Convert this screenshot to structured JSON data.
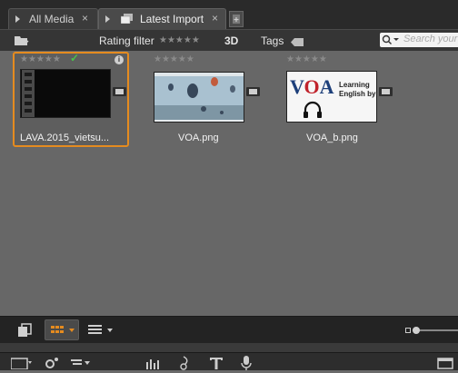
{
  "tabs": [
    {
      "label": "All Media",
      "close": "×"
    },
    {
      "label": "Latest Import",
      "close": "×"
    }
  ],
  "toolbar": {
    "rating_filter_label": "Rating filter",
    "rating_stars": "★★★★★",
    "three_d_label": "3D",
    "tags_label": "Tags",
    "search_placeholder": "Search your"
  },
  "media_items": [
    {
      "filename": "LAVA.2015_vietsu...",
      "stars": "★★★★★",
      "checked": true,
      "checkmark": "✓",
      "info_icon": "i",
      "selected": true
    },
    {
      "filename": "VOA.png",
      "stars": "★★★★★",
      "checked": false,
      "selected": false
    },
    {
      "filename": "VOA_b.png",
      "stars": "★★★★★",
      "checked": false,
      "selected": false,
      "thumb_text_brand": "VOA",
      "thumb_text_line1": "Learning",
      "thumb_text_line2": "English by"
    }
  ],
  "colors": {
    "selection_border": "#e58b1f",
    "view_grid_active": "#e58b1f",
    "check_green": "#49c24b",
    "voa_red": "#c0222b",
    "voa_blue": "#1d3f7a"
  },
  "icons": {
    "bottom_left": [
      "copy-icon",
      "grid-view-icon",
      "list-view-icon"
    ],
    "bottom_toolbar": [
      "timeline-icon",
      "settings-icon",
      "align-icon",
      "audio-levels-icon",
      "music-note-icon",
      "title-icon",
      "microphone-icon",
      "panel-icon"
    ]
  }
}
